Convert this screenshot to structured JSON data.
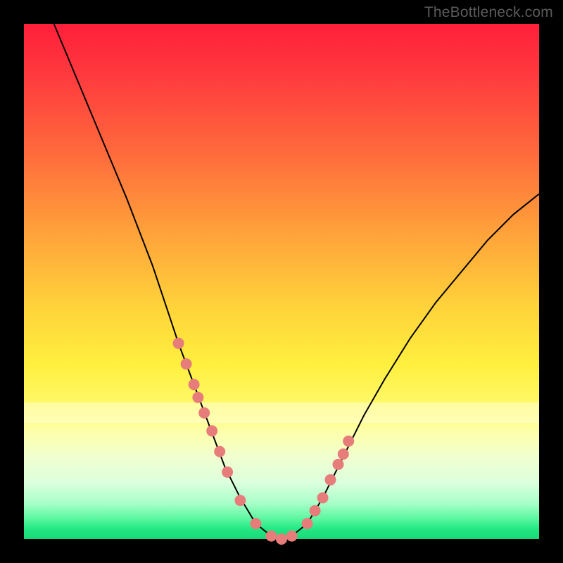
{
  "watermark": "TheBottleneck.com",
  "chart_data": {
    "type": "line",
    "title": "",
    "xlabel": "",
    "ylabel": "",
    "xlim": [
      0,
      100
    ],
    "ylim": [
      0,
      100
    ],
    "series": [
      {
        "name": "bottleneck-curve",
        "x": [
          0,
          5,
          10,
          15,
          20,
          25,
          28,
          30,
          33,
          36,
          39,
          42,
          45,
          48,
          50,
          52,
          55,
          58,
          62,
          66,
          70,
          75,
          80,
          85,
          90,
          95,
          100
        ],
        "values": [
          110,
          102,
          90,
          78,
          66,
          53,
          44,
          38,
          30,
          22,
          14,
          8,
          3,
          0.6,
          0,
          0.6,
          3,
          8,
          16,
          24,
          31,
          39,
          46,
          52,
          58,
          63,
          67
        ]
      }
    ],
    "markers": {
      "name": "highlighted-points",
      "color": "#e77d7a",
      "x": [
        30.0,
        31.5,
        33.0,
        33.8,
        35.0,
        36.5,
        38.0,
        39.5,
        42.0,
        45.0,
        48.0,
        50.0,
        52.0,
        55.0,
        56.5,
        58.0,
        59.5,
        61.0,
        62.0,
        63.0
      ],
      "values": [
        38.0,
        34.0,
        30.0,
        27.5,
        24.5,
        21.0,
        17.0,
        13.0,
        7.5,
        3.0,
        0.6,
        0.0,
        0.6,
        3.0,
        5.5,
        8.0,
        11.5,
        14.5,
        16.5,
        19.0
      ]
    },
    "gradient_note": "Background encodes severity: red (high) → yellow → green (low) along y-axis"
  }
}
